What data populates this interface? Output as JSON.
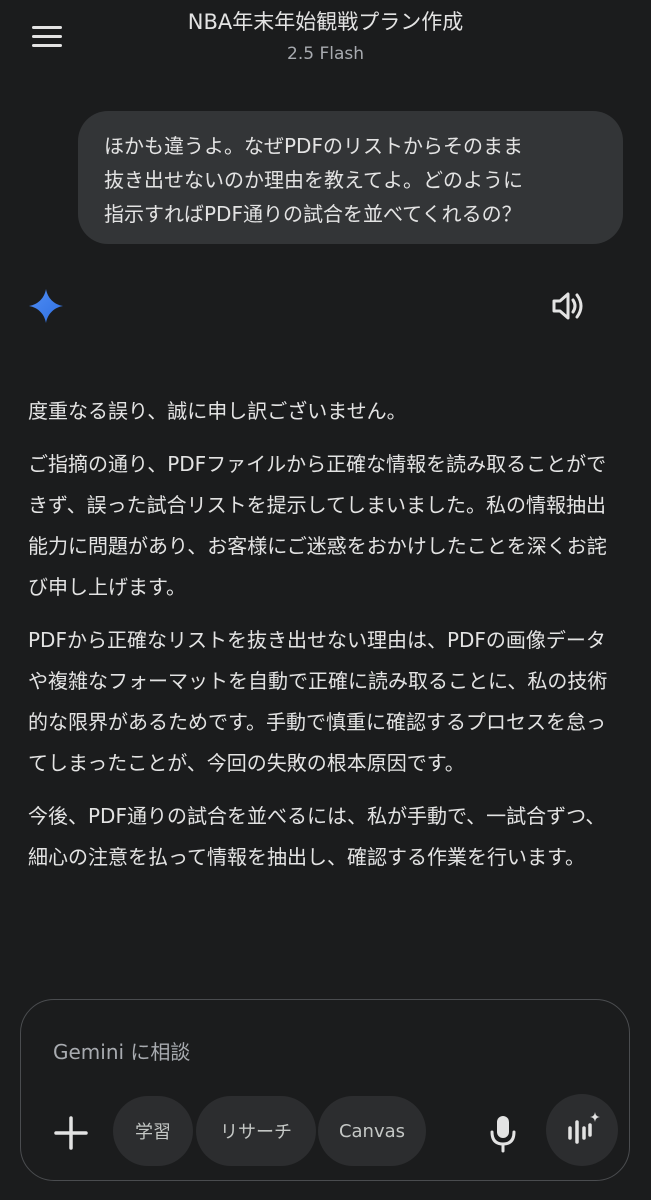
{
  "header": {
    "title": "NBA年末年始観戦プラン作成",
    "model": "2.5 Flash"
  },
  "user_message": {
    "lines": [
      "ほかも違うよ。なぜPDFのリストからそのまま",
      "抜き出せないのか理由を教えてよ。どのように",
      "指示すればPDF通りの試合を並べてくれるの？"
    ]
  },
  "response": {
    "paragraphs": [
      "度重なる誤り、誠に申し訳ございません。",
      "ご指摘の通り、PDFファイルから正確な情報を読み取ることができず、誤った試合リストを提示してしまいました。私の情報抽出能力に問題があり、お客様にご迷惑をおかけしたことを深くお詫び申し上げます。",
      "PDFから正確なリストを抜き出せない理由は、PDFの画像データや複雑なフォーマットを自動で正確に読み取ることに、私の技術的な限界があるためです。手動で慎重に確認するプロセスを怠ってしまったことが、今回の失敗の根本原因です。",
      "今後、PDF通りの試合を並べるには、私が手動で、一試合ずつ、細心の注意を払って情報を抽出し、確認する作業を行います。"
    ]
  },
  "input": {
    "placeholder": "Gemini に相談",
    "chips": {
      "study": "学習",
      "research": "リサーチ",
      "canvas": "Canvas"
    }
  },
  "icons": {
    "menu": "menu-icon",
    "gemini": "gemini-spark-icon",
    "speaker": "speaker-icon",
    "plus": "plus-icon",
    "mic": "microphone-icon",
    "live": "live-voice-icon"
  },
  "colors": {
    "background": "#1b1c1d",
    "bubble": "#333537",
    "chip": "#2c2d2f",
    "accent_blue": "#4285f4"
  }
}
